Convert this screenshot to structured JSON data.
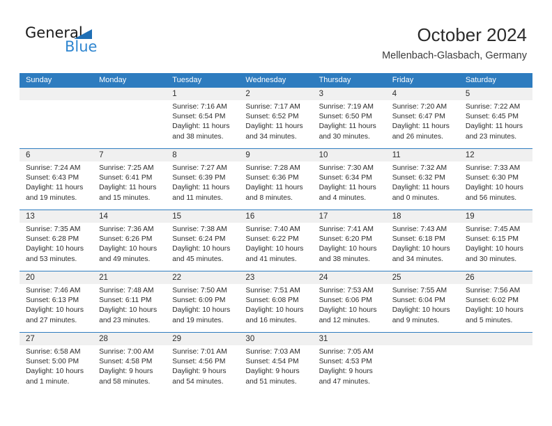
{
  "brand": {
    "name_part1": "General",
    "name_part2": "Blue",
    "triangle_color": "#1f6fb5",
    "blue_text_color": "#2f86d0"
  },
  "header": {
    "title": "October 2024",
    "subtitle": "Mellenbach-Glasbach, Germany"
  },
  "theme": {
    "header_blue": "#2e7cbf",
    "day_band_gray": "#f0f0f0",
    "text_dark": "#2b2b2b"
  },
  "weekdays": [
    "Sunday",
    "Monday",
    "Tuesday",
    "Wednesday",
    "Thursday",
    "Friday",
    "Saturday"
  ],
  "weeks": [
    [
      {
        "day": "",
        "lines": []
      },
      {
        "day": "",
        "lines": []
      },
      {
        "day": "1",
        "lines": [
          "Sunrise: 7:16 AM",
          "Sunset: 6:54 PM",
          "Daylight: 11 hours",
          "and 38 minutes."
        ]
      },
      {
        "day": "2",
        "lines": [
          "Sunrise: 7:17 AM",
          "Sunset: 6:52 PM",
          "Daylight: 11 hours",
          "and 34 minutes."
        ]
      },
      {
        "day": "3",
        "lines": [
          "Sunrise: 7:19 AM",
          "Sunset: 6:50 PM",
          "Daylight: 11 hours",
          "and 30 minutes."
        ]
      },
      {
        "day": "4",
        "lines": [
          "Sunrise: 7:20 AM",
          "Sunset: 6:47 PM",
          "Daylight: 11 hours",
          "and 26 minutes."
        ]
      },
      {
        "day": "5",
        "lines": [
          "Sunrise: 7:22 AM",
          "Sunset: 6:45 PM",
          "Daylight: 11 hours",
          "and 23 minutes."
        ]
      }
    ],
    [
      {
        "day": "6",
        "lines": [
          "Sunrise: 7:24 AM",
          "Sunset: 6:43 PM",
          "Daylight: 11 hours",
          "and 19 minutes."
        ]
      },
      {
        "day": "7",
        "lines": [
          "Sunrise: 7:25 AM",
          "Sunset: 6:41 PM",
          "Daylight: 11 hours",
          "and 15 minutes."
        ]
      },
      {
        "day": "8",
        "lines": [
          "Sunrise: 7:27 AM",
          "Sunset: 6:39 PM",
          "Daylight: 11 hours",
          "and 11 minutes."
        ]
      },
      {
        "day": "9",
        "lines": [
          "Sunrise: 7:28 AM",
          "Sunset: 6:36 PM",
          "Daylight: 11 hours",
          "and 8 minutes."
        ]
      },
      {
        "day": "10",
        "lines": [
          "Sunrise: 7:30 AM",
          "Sunset: 6:34 PM",
          "Daylight: 11 hours",
          "and 4 minutes."
        ]
      },
      {
        "day": "11",
        "lines": [
          "Sunrise: 7:32 AM",
          "Sunset: 6:32 PM",
          "Daylight: 11 hours",
          "and 0 minutes."
        ]
      },
      {
        "day": "12",
        "lines": [
          "Sunrise: 7:33 AM",
          "Sunset: 6:30 PM",
          "Daylight: 10 hours",
          "and 56 minutes."
        ]
      }
    ],
    [
      {
        "day": "13",
        "lines": [
          "Sunrise: 7:35 AM",
          "Sunset: 6:28 PM",
          "Daylight: 10 hours",
          "and 53 minutes."
        ]
      },
      {
        "day": "14",
        "lines": [
          "Sunrise: 7:36 AM",
          "Sunset: 6:26 PM",
          "Daylight: 10 hours",
          "and 49 minutes."
        ]
      },
      {
        "day": "15",
        "lines": [
          "Sunrise: 7:38 AM",
          "Sunset: 6:24 PM",
          "Daylight: 10 hours",
          "and 45 minutes."
        ]
      },
      {
        "day": "16",
        "lines": [
          "Sunrise: 7:40 AM",
          "Sunset: 6:22 PM",
          "Daylight: 10 hours",
          "and 41 minutes."
        ]
      },
      {
        "day": "17",
        "lines": [
          "Sunrise: 7:41 AM",
          "Sunset: 6:20 PM",
          "Daylight: 10 hours",
          "and 38 minutes."
        ]
      },
      {
        "day": "18",
        "lines": [
          "Sunrise: 7:43 AM",
          "Sunset: 6:18 PM",
          "Daylight: 10 hours",
          "and 34 minutes."
        ]
      },
      {
        "day": "19",
        "lines": [
          "Sunrise: 7:45 AM",
          "Sunset: 6:15 PM",
          "Daylight: 10 hours",
          "and 30 minutes."
        ]
      }
    ],
    [
      {
        "day": "20",
        "lines": [
          "Sunrise: 7:46 AM",
          "Sunset: 6:13 PM",
          "Daylight: 10 hours",
          "and 27 minutes."
        ]
      },
      {
        "day": "21",
        "lines": [
          "Sunrise: 7:48 AM",
          "Sunset: 6:11 PM",
          "Daylight: 10 hours",
          "and 23 minutes."
        ]
      },
      {
        "day": "22",
        "lines": [
          "Sunrise: 7:50 AM",
          "Sunset: 6:09 PM",
          "Daylight: 10 hours",
          "and 19 minutes."
        ]
      },
      {
        "day": "23",
        "lines": [
          "Sunrise: 7:51 AM",
          "Sunset: 6:08 PM",
          "Daylight: 10 hours",
          "and 16 minutes."
        ]
      },
      {
        "day": "24",
        "lines": [
          "Sunrise: 7:53 AM",
          "Sunset: 6:06 PM",
          "Daylight: 10 hours",
          "and 12 minutes."
        ]
      },
      {
        "day": "25",
        "lines": [
          "Sunrise: 7:55 AM",
          "Sunset: 6:04 PM",
          "Daylight: 10 hours",
          "and 9 minutes."
        ]
      },
      {
        "day": "26",
        "lines": [
          "Sunrise: 7:56 AM",
          "Sunset: 6:02 PM",
          "Daylight: 10 hours",
          "and 5 minutes."
        ]
      }
    ],
    [
      {
        "day": "27",
        "lines": [
          "Sunrise: 6:58 AM",
          "Sunset: 5:00 PM",
          "Daylight: 10 hours",
          "and 1 minute."
        ]
      },
      {
        "day": "28",
        "lines": [
          "Sunrise: 7:00 AM",
          "Sunset: 4:58 PM",
          "Daylight: 9 hours",
          "and 58 minutes."
        ]
      },
      {
        "day": "29",
        "lines": [
          "Sunrise: 7:01 AM",
          "Sunset: 4:56 PM",
          "Daylight: 9 hours",
          "and 54 minutes."
        ]
      },
      {
        "day": "30",
        "lines": [
          "Sunrise: 7:03 AM",
          "Sunset: 4:54 PM",
          "Daylight: 9 hours",
          "and 51 minutes."
        ]
      },
      {
        "day": "31",
        "lines": [
          "Sunrise: 7:05 AM",
          "Sunset: 4:53 PM",
          "Daylight: 9 hours",
          "and 47 minutes."
        ]
      },
      {
        "day": "",
        "lines": []
      },
      {
        "day": "",
        "lines": []
      }
    ]
  ]
}
